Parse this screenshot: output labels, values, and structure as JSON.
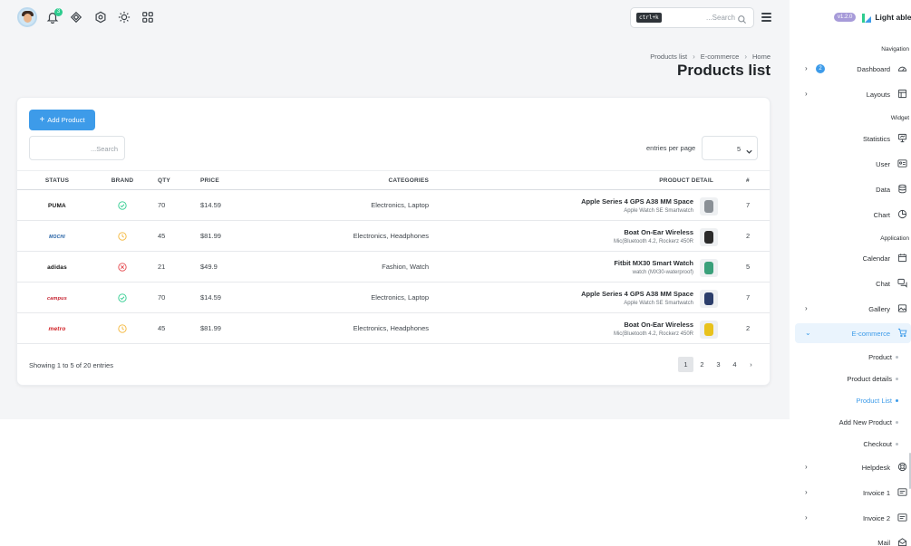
{
  "topbar": {
    "notifications_count": "3",
    "search_shortcut": "ctrl+k",
    "search_placeholder": "...Search"
  },
  "breadcrumb": [
    "Products list",
    "E-commerce",
    "Home"
  ],
  "page_title": "Products list",
  "card": {
    "add_button": "Add Product",
    "search_placeholder": "...Search",
    "entries_label": "entries per page",
    "entries_value": "5",
    "columns": [
      "STATUS",
      "BRAND",
      "QTY",
      "PRICE",
      "CATEGORIES",
      "PRODUCT DETAIL",
      "#"
    ],
    "rows": [
      {
        "brand": "PUMA",
        "status": "done",
        "qty": "70",
        "price": "$14.59",
        "categories": "Electronics, Laptop",
        "name": "Apple Series 4 GPS A38 MM Space",
        "sub": "Apple Watch SE Smartwatch",
        "num": "7",
        "thumb_color": "#8a9096"
      },
      {
        "brand": "MOCHI",
        "status": "pending",
        "qty": "45",
        "price": "$81.99",
        "categories": "Electronics, Headphones",
        "name": "Boat On-Ear Wireless",
        "sub": "Mic(Bluetooth 4.2, Rockerz 450R",
        "num": "2",
        "thumb_color": "#2b2b2b"
      },
      {
        "brand": "adidas",
        "status": "cancelled",
        "qty": "21",
        "price": "$49.9",
        "categories": "Fashion, Watch",
        "name": "Fitbit MX30 Smart Watch",
        "sub": "watch (MX30-waterproof)",
        "num": "5",
        "thumb_color": "#3aa07a"
      },
      {
        "brand": "campus",
        "status": "done",
        "qty": "70",
        "price": "$14.59",
        "categories": "Electronics, Laptop",
        "name": "Apple Series 4 GPS A38 MM Space",
        "sub": "Apple Watch SE Smartwatch",
        "num": "7",
        "thumb_color": "#2c3e6b"
      },
      {
        "brand": "metro",
        "status": "pending",
        "qty": "45",
        "price": "$81.99",
        "categories": "Electronics, Headphones",
        "name": "Boat On-Ear Wireless",
        "sub": "Mic(Bluetooth 4.2, Rockerz 450R",
        "num": "2",
        "thumb_color": "#e8c21c"
      }
    ],
    "showing": "Showing 1 to 5 of 20 entries",
    "pages": [
      "1",
      "2",
      "3",
      "4"
    ],
    "next": "›"
  },
  "sidebar": {
    "version": "v1.2.0",
    "brand": "Light able",
    "sections": {
      "navigation": "Navigation",
      "widget": "Widget",
      "application": "Application"
    },
    "dashboard_badge": "2",
    "items": {
      "dashboard": "Dashboard",
      "layouts": "Layouts",
      "statistics": "Statistics",
      "user": "User",
      "data": "Data",
      "chart": "Chart",
      "calendar": "Calendar",
      "chat": "Chat",
      "gallery": "Gallery",
      "ecommerce": "E-commerce",
      "product": "Product",
      "product_details": "Product details",
      "product_list": "Product List",
      "add_new_product": "Add New Product",
      "checkout": "Checkout",
      "helpdesk": "Helpdesk",
      "invoice1": "Invoice 1",
      "invoice2": "Invoice 2",
      "mail": "Mail"
    }
  },
  "colors": {
    "accent": "#3d9be9",
    "success": "#2ecc8f",
    "warning": "#f4b73a",
    "danger": "#e5484d"
  }
}
